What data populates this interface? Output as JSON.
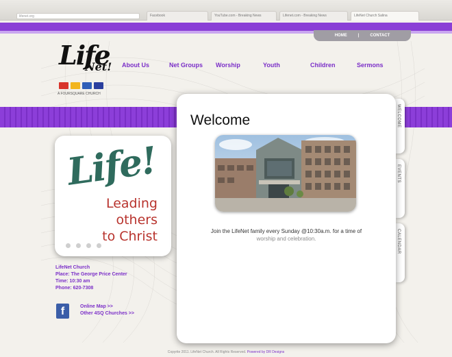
{
  "browser": {
    "tabs": [
      {
        "label": "Facebook"
      },
      {
        "label": "YouTube.com - Breaking News"
      },
      {
        "label": "Lifenet.com - Breaking News"
      },
      {
        "label": "LifeNet Church Salina"
      }
    ],
    "address": "lifenet.org"
  },
  "topnav": {
    "home": "HOME",
    "separator": "|",
    "contact": "CONTACT"
  },
  "logo": {
    "life": "Life",
    "net": "Net!",
    "tagline": "A FOURSQUARE CHURCH",
    "block_colors": [
      "#d8342b",
      "#f2b51d",
      "#2f5fb8",
      "#2a3f9e"
    ]
  },
  "nav": [
    "About Us",
    "Net Groups",
    "Worship",
    "Youth",
    "Children",
    "Sermons"
  ],
  "promo": {
    "title": "Life!",
    "line1": "Leading",
    "line2": "others",
    "line3": "to Christ"
  },
  "info": {
    "church": "LifeNet Church",
    "place": "Place:  The George Price Center",
    "time": "Time:  10:30 am",
    "phone": "Phone:  620-7308"
  },
  "links": {
    "map": "Online Map >>",
    "other": "Other 4SQ Churches >>"
  },
  "content": {
    "title": "Welcome",
    "caption_line1": "Join the LifeNet family every Sunday @10:30a.m. for a time of",
    "caption_line2": "worship and celebration."
  },
  "sidetabs": [
    "WELCOME",
    "EVENTS",
    "CALENDAR"
  ],
  "footer": {
    "text": "Copyrite 2011. LifeNet Church. All Rights Reserved.",
    "link": "Powered by DR Designs"
  },
  "colors": {
    "accent": "#8a3fd6",
    "link": "#7b2fc8",
    "promo_green": "#2f6b5d",
    "promo_red": "#b8332d"
  }
}
